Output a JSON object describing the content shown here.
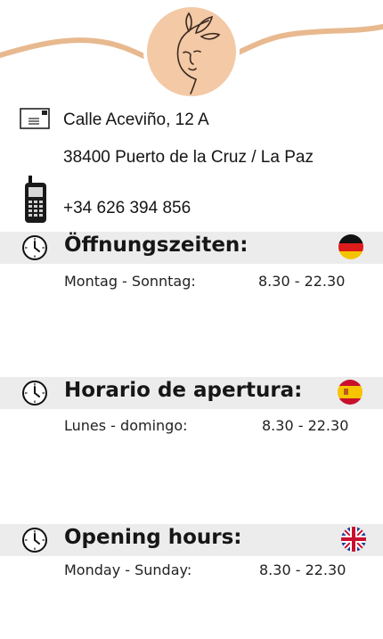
{
  "colors": {
    "wave": "#e8b98f",
    "logo_fill": "#f3c9a6",
    "logo_ring": "#ffffff",
    "band": "#ececec",
    "text": "#151515"
  },
  "icons": {
    "envelope": "envelope-icon",
    "phone": "mobile-phone-icon",
    "clock": "clock-icon",
    "flags": [
      "germany-flag-icon",
      "spain-flag-icon",
      "uk-flag-icon"
    ],
    "logo": "face-with-leaves-logo"
  },
  "contact": {
    "street": "Calle Aceviño, 12 A",
    "city": "38400 Puerto de la Cruz / La Paz",
    "phone": "+34 626 394 856"
  },
  "opening_hours": [
    {
      "title": "Öffnungszeiten:",
      "days": "Montag - Sonntag:",
      "time": "8.30 - 22.30",
      "flag": "germany-flag-icon"
    },
    {
      "title": "Horario de apertura:",
      "days": "Lunes - domingo:",
      "time": "8.30 - 22.30",
      "flag": "spain-flag-icon"
    },
    {
      "title": "Opening hours:",
      "days": "Monday - Sunday:",
      "time": "8.30 - 22.30",
      "flag": "uk-flag-icon"
    }
  ]
}
